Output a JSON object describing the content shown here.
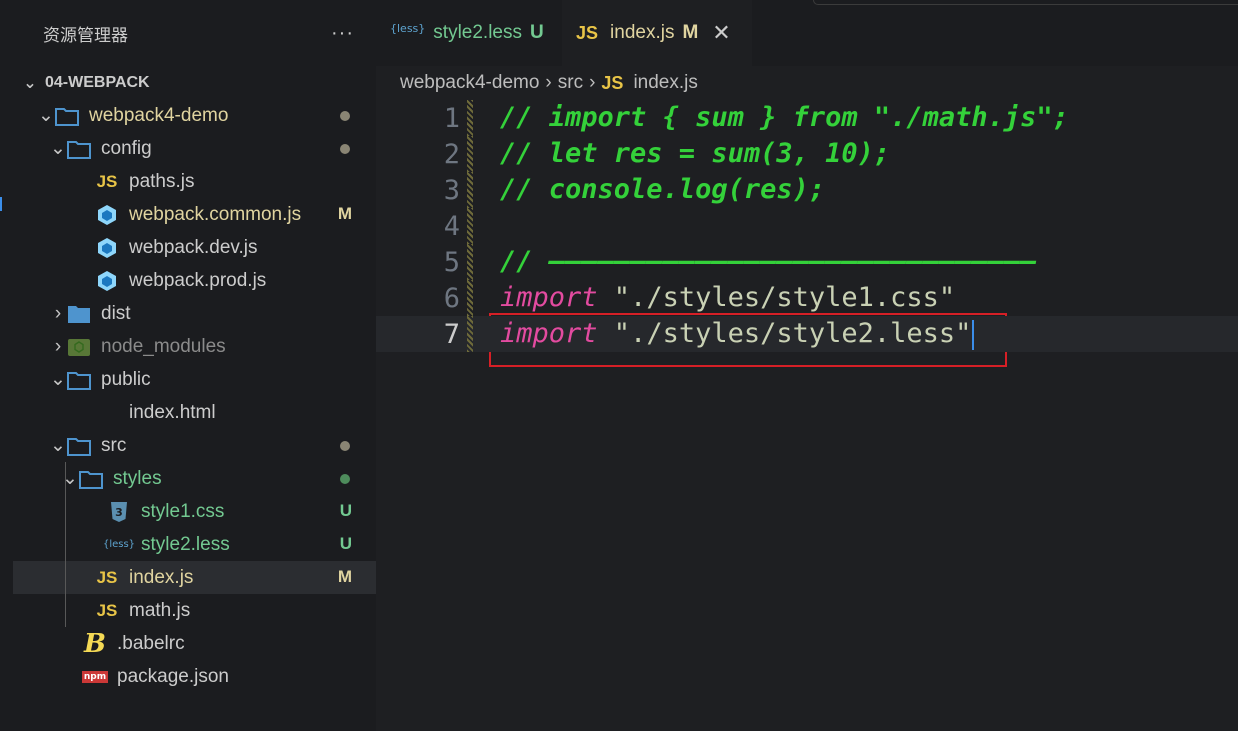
{
  "sidebar": {
    "title": "资源管理器",
    "more": "···",
    "root": "04-WEBPACK",
    "items": [
      {
        "label": "webpack4-demo",
        "icon": "folder-icon",
        "expanded": true,
        "state": "dot",
        "color": "#e0d4a0"
      },
      {
        "label": "config",
        "icon": "folder-icon",
        "expanded": true,
        "state": "dot",
        "color": "#cccccc"
      },
      {
        "label": "paths.js",
        "icon": "js-icon",
        "color": "#cccccc"
      },
      {
        "label": "webpack.common.js",
        "icon": "webpack-icon",
        "state": "M",
        "color": "#e0d4a0"
      },
      {
        "label": "webpack.dev.js",
        "icon": "webpack-icon",
        "color": "#cccccc"
      },
      {
        "label": "webpack.prod.js",
        "icon": "webpack-icon",
        "color": "#cccccc"
      },
      {
        "label": "dist",
        "icon": "folder-icon",
        "expanded": false,
        "color": "#cccccc"
      },
      {
        "label": "node_modules",
        "icon": "node-folder-icon",
        "expanded": false,
        "color": "#8b8b8b"
      },
      {
        "label": "public",
        "icon": "folder-icon",
        "expanded": true,
        "color": "#cccccc"
      },
      {
        "label": "index.html",
        "icon": "html-icon",
        "color": "#cccccc"
      },
      {
        "label": "src",
        "icon": "folder-icon",
        "expanded": true,
        "state": "dot",
        "color": "#cccccc"
      },
      {
        "label": "styles",
        "icon": "folder-icon",
        "expanded": true,
        "state": "dot-green",
        "color": "#73c991"
      },
      {
        "label": "style1.css",
        "icon": "css-icon",
        "state": "U",
        "color": "#73c991"
      },
      {
        "label": "style2.less",
        "icon": "less-icon",
        "state": "U",
        "color": "#73c991"
      },
      {
        "label": "index.js",
        "icon": "js-icon",
        "state": "M",
        "color": "#e0d4a0"
      },
      {
        "label": "math.js",
        "icon": "js-icon",
        "color": "#cccccc"
      },
      {
        "label": ".babelrc",
        "icon": "babel-icon",
        "color": "#cccccc"
      },
      {
        "label": "package.json",
        "icon": "npm-icon",
        "color": "#cccccc"
      }
    ],
    "less_glyph": "{less}",
    "js_glyph": "JS",
    "npm_glyph": "npm",
    "babel_glyph": "B",
    "html_glyph": "</>",
    "css_glyph": "3"
  },
  "tabs": [
    {
      "label": "style2.less",
      "icon": "less-icon",
      "glyph": "{less}",
      "state": "U",
      "active": false
    },
    {
      "label": "index.js",
      "icon": "js-icon",
      "glyph": "JS",
      "state": "M",
      "active": true,
      "close": "✕"
    }
  ],
  "breadcrumb": {
    "parts": [
      "webpack4-demo",
      "src",
      "index.js"
    ],
    "sep": "›",
    "file_glyph": "JS"
  },
  "code": {
    "lines": [
      {
        "n": "1",
        "text": "// import { sum } from \"./math.js\";"
      },
      {
        "n": "2",
        "text": "// let res = sum(3, 10);"
      },
      {
        "n": "3",
        "text": "// console.log(res);"
      },
      {
        "n": "4",
        "text": ""
      },
      {
        "n": "5",
        "text": "// ——————————————————————————————"
      },
      {
        "n": "6",
        "kw": "import",
        "str": " \"./styles/style1.css\""
      },
      {
        "n": "7",
        "kw": "import",
        "str": " \"./styles/style2.less\""
      }
    ],
    "current_line": 7
  },
  "colors": {
    "accent": "#3b8eea",
    "modified": "#e0d4a0",
    "untracked": "#73c991",
    "highlight_box": "#d61f26",
    "comment": "#34d13a",
    "keyword": "#e34ba0"
  }
}
